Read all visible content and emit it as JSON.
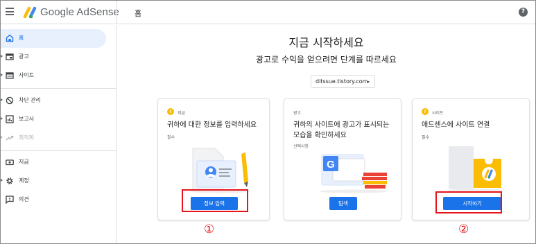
{
  "app": {
    "brand": "Google AdSense",
    "page_title": "홈",
    "help_label": "?"
  },
  "sidebar": {
    "items": [
      {
        "label": "홈",
        "icon": "home-icon",
        "state": "active"
      },
      {
        "label": "광고",
        "icon": "ads-icon",
        "state": "normal"
      },
      {
        "label": "사이트",
        "icon": "sites-icon",
        "state": "normal"
      },
      {
        "label": "차단 관리",
        "icon": "block-icon",
        "state": "normal"
      },
      {
        "label": "보고서",
        "icon": "reports-icon",
        "state": "normal"
      },
      {
        "label": "최적화",
        "icon": "optimization-icon",
        "state": "disabled"
      },
      {
        "label": "지급",
        "icon": "payments-icon",
        "state": "normal"
      },
      {
        "label": "계정",
        "icon": "account-icon",
        "state": "normal"
      },
      {
        "label": "의견",
        "icon": "feedback-icon",
        "state": "normal"
      }
    ]
  },
  "main": {
    "heading": "지금 시작하세요",
    "subheading": "광고로 수익을 얻으려면 단계를 따르세요",
    "site_selector": "ditssue.tistory.com"
  },
  "cards": [
    {
      "tag": "지급",
      "has_warning": true,
      "title": "귀하에 대한 정보를 입력하세요",
      "note": "필수",
      "button": "정보 입력",
      "marker": "①"
    },
    {
      "tag": "광고",
      "has_warning": false,
      "title": "귀하의 사이트에 광고가 표시되는 모습을 확인하세요",
      "note": "선택사항",
      "button": "탐색",
      "marker": ""
    },
    {
      "tag": "사이트",
      "has_warning": true,
      "title": "애드센스에 사이트 연결",
      "note": "필수",
      "button": "시작하기",
      "marker": "②"
    }
  ],
  "colors": {
    "accent": "#1a73e8",
    "active_bg": "#e8f0fe",
    "warning": "#fbbc04",
    "annotation": "#e8141b"
  }
}
